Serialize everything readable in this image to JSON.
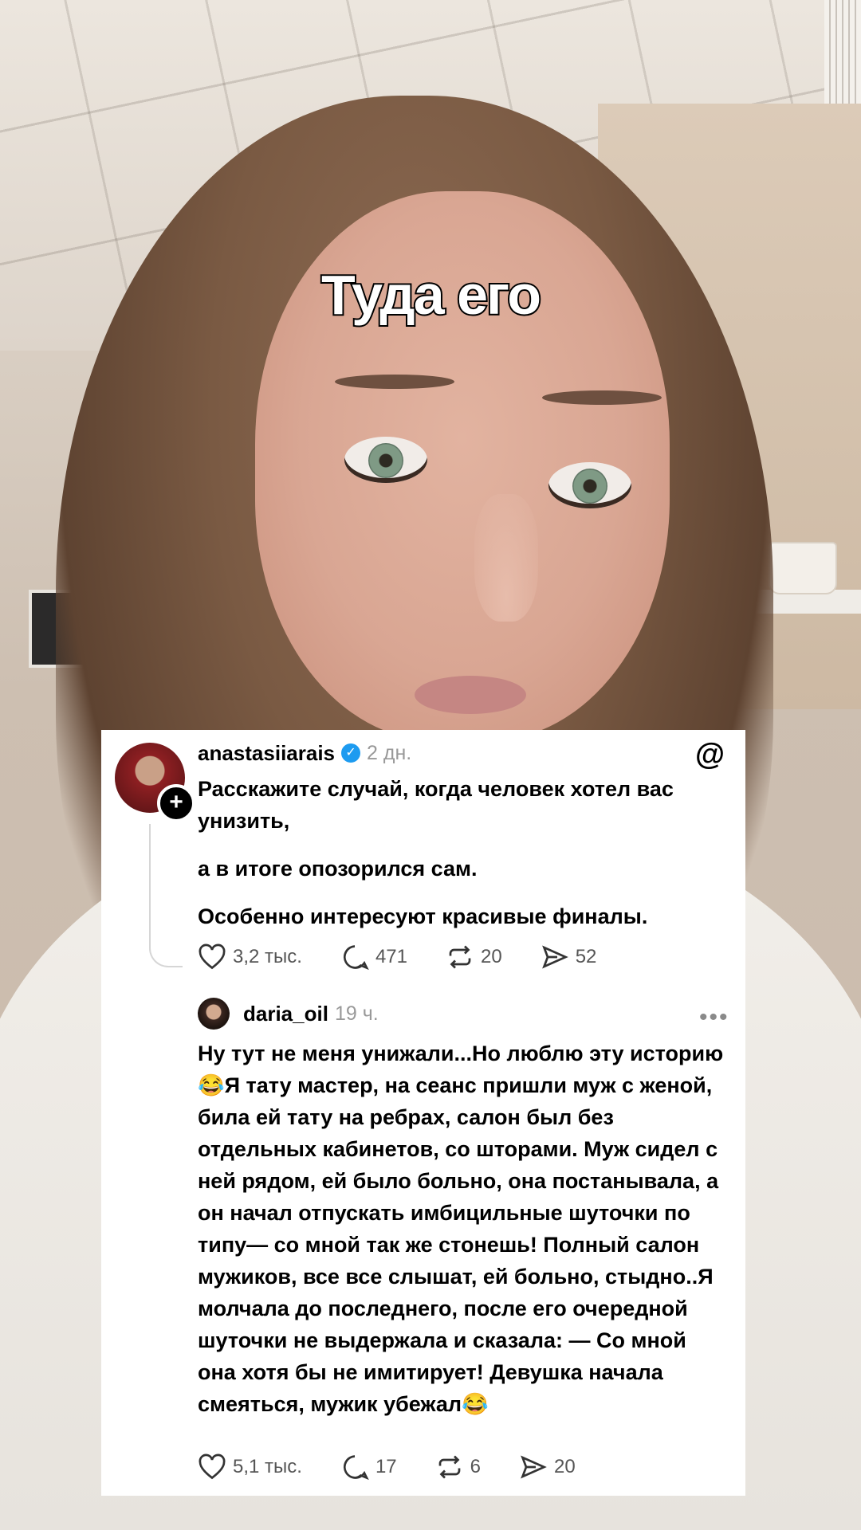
{
  "video": {
    "caption": "Туда его"
  },
  "post": {
    "username": "anastasiiarais",
    "verified": true,
    "time": "2 дн.",
    "paragraphs": [
      "Расскажите случай, когда человек хотел вас унизить,",
      "а в итоге опозорился сам.",
      "Особенно интересуют красивые финалы."
    ],
    "likes": "3,2 тыс.",
    "comments": "471",
    "reposts": "20",
    "shares": "52"
  },
  "reply": {
    "username": "daria_oil",
    "time": "19 ч.",
    "text": "Ну тут не меня унижали...Но люблю эту историю😂Я тату мастер, на сеанс пришли муж с женой, била ей тату на ребрах, салон был без отдельных кабинетов, со шторами. Муж сидел с ней рядом, ей было больно, она постанывала, а он начал отпускать имбицильные шуточки по типу— со мной так же стонешь! Полный салон мужиков, все все слышат, ей больно, стыдно..Я молчала до последнего, после его очередной шуточки не выдержала и сказала: — Со мной она хотя бы не имитирует!  Девушка начала смеяться, мужик убежал😂",
    "likes": "5,1 тыс.",
    "comments": "17",
    "reposts": "6",
    "shares": "20"
  },
  "icons": {
    "follow": "+",
    "verified": "✓",
    "threads_logo": "@",
    "more": "•••"
  },
  "colors": {
    "verified_blue": "#1d9bf0",
    "time_gray": "#999999",
    "card_bg": "#ffffff"
  }
}
